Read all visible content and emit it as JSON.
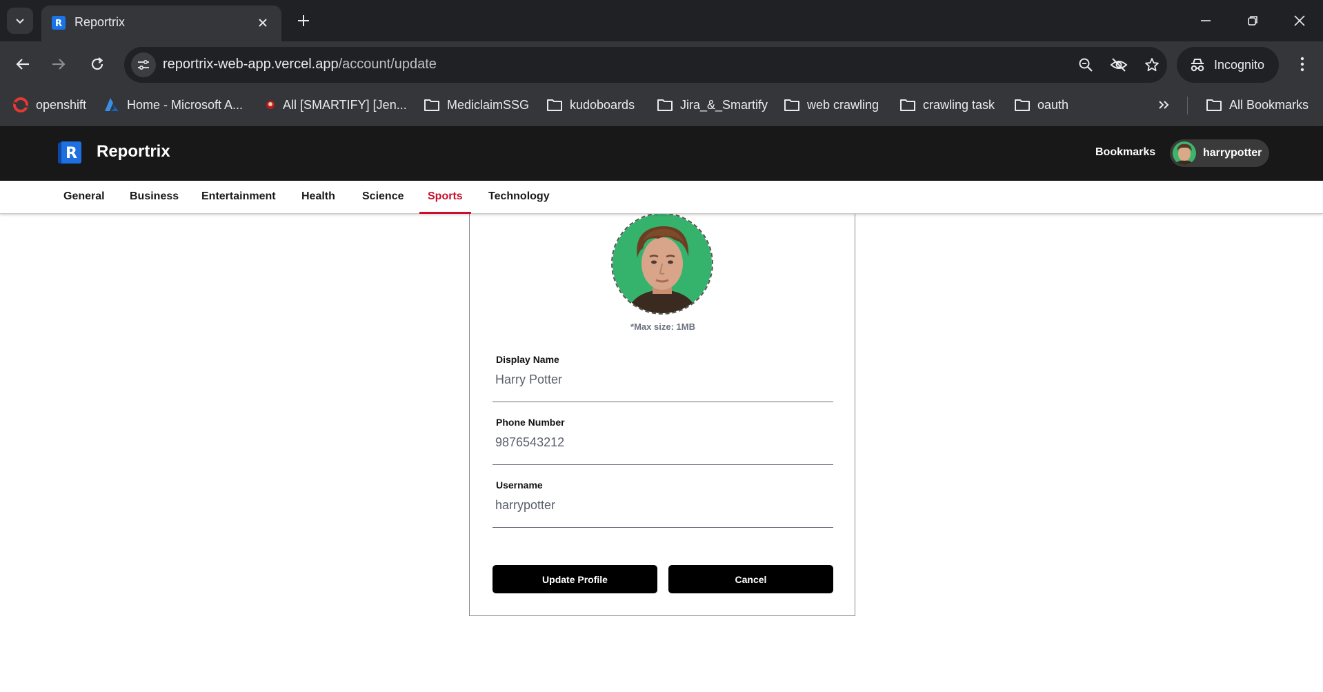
{
  "browser": {
    "tab_title": "Reportrix",
    "url_host": "reportrix-web-app.vercel.app",
    "url_path": "/account/update",
    "incognito_label": "Incognito",
    "bookmarks": [
      {
        "label": "openshift",
        "icon": "openshift-icon"
      },
      {
        "label": "Home - Microsoft A...",
        "icon": "azure-icon"
      },
      {
        "label": "All [SMARTIFY] [Jen...",
        "icon": "jenkins-icon"
      },
      {
        "label": "MediclaimSSG",
        "icon": "folder-icon"
      },
      {
        "label": "kudoboards",
        "icon": "folder-icon"
      },
      {
        "label": "Jira_&_Smartify",
        "icon": "folder-icon"
      },
      {
        "label": "web crawling",
        "icon": "folder-icon"
      },
      {
        "label": "crawling task",
        "icon": "folder-icon"
      },
      {
        "label": "oauth",
        "icon": "folder-icon"
      }
    ],
    "all_bookmarks_label": "All Bookmarks"
  },
  "header": {
    "logo_letter": "R",
    "brand": "Reportrix",
    "bookmarks_link": "Bookmarks",
    "username": "harrypotter"
  },
  "categories": {
    "items": [
      "General",
      "Business",
      "Entertainment",
      "Health",
      "Science",
      "Sports",
      "Technology"
    ],
    "active": "Sports",
    "active_color": "#c8102e"
  },
  "profile_form": {
    "max_size_note": "*Max size: 1MB",
    "display_name": {
      "label": "Display Name",
      "value": "Harry Potter"
    },
    "phone_number": {
      "label": "Phone Number",
      "value": "9876543212"
    },
    "username": {
      "label": "Username",
      "value": "harrypotter"
    },
    "update_button": "Update Profile",
    "cancel_button": "Cancel"
  }
}
